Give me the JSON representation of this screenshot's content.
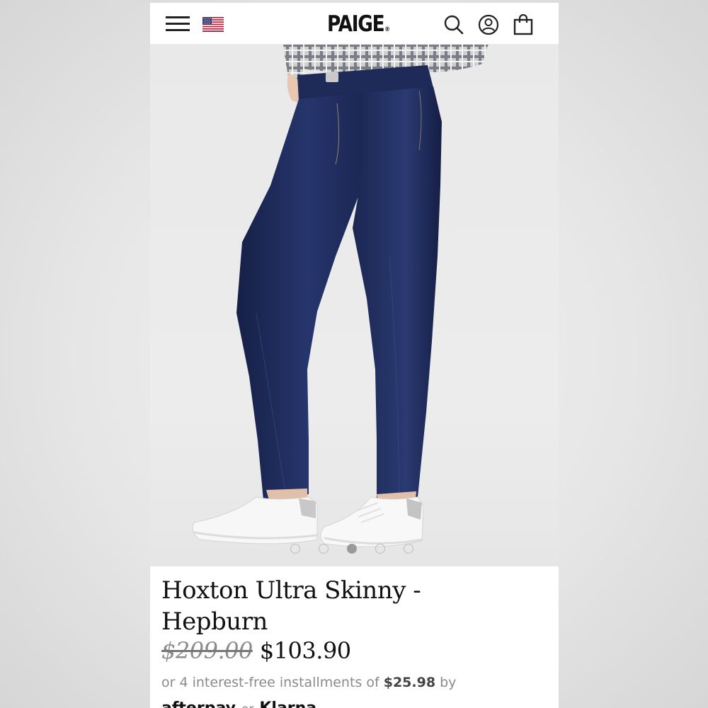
{
  "header": {
    "logo": "PAIGE",
    "logo_mark": "®",
    "menu_icon": "hamburger-menu-icon",
    "flag_icon": "us-flag-icon",
    "search_icon": "search-icon",
    "account_icon": "user-account-icon",
    "bag_icon": "shopping-bag-icon"
  },
  "gallery": {
    "dot_count": 5,
    "active_index": 2
  },
  "product": {
    "title": "Hoxton Ultra Skinny - Hepburn",
    "original_price": "$209.00",
    "sale_price": "$103.90",
    "installments_prefix": "or 4 interest-free installments of",
    "installment_amount": "$25.98",
    "installments_suffix": "by",
    "pay_provider_1": "afterpay",
    "pay_or": "or",
    "pay_provider_2": "Klarna."
  },
  "colors": {
    "denim": "#1f2c5c",
    "background": "#ececec",
    "text": "#111111",
    "muted_text": "#8a8a8a"
  }
}
